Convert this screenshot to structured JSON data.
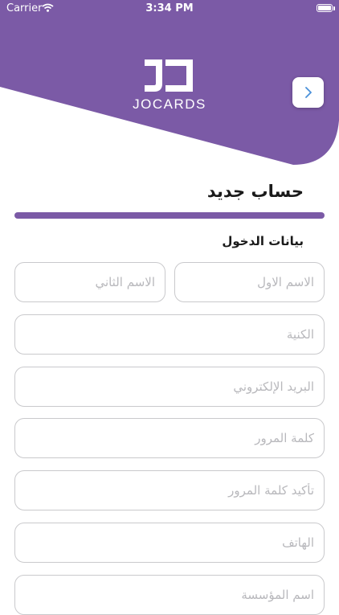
{
  "status_bar": {
    "carrier": "Carrier",
    "time": "3:34 PM"
  },
  "brand": {
    "name": "JOCARDS",
    "color": "#7b5aa6"
  },
  "icons": {
    "back": "chevron-right-icon",
    "wifi": "wifi-icon",
    "battery": "battery-icon"
  },
  "page": {
    "title": "حساب جديد"
  },
  "form": {
    "section_title": "بيانات الدخول",
    "fields": {
      "first_name": "الاسم الاول",
      "second_name": "الاسم الثاني",
      "family_name": "الكنية",
      "email": "البريد الإلكتروني",
      "password": "كلمة المرور",
      "confirm_password": "تأكيد كلمة المرور",
      "phone": "الهاتف",
      "organization": "اسم المؤسسة"
    }
  }
}
